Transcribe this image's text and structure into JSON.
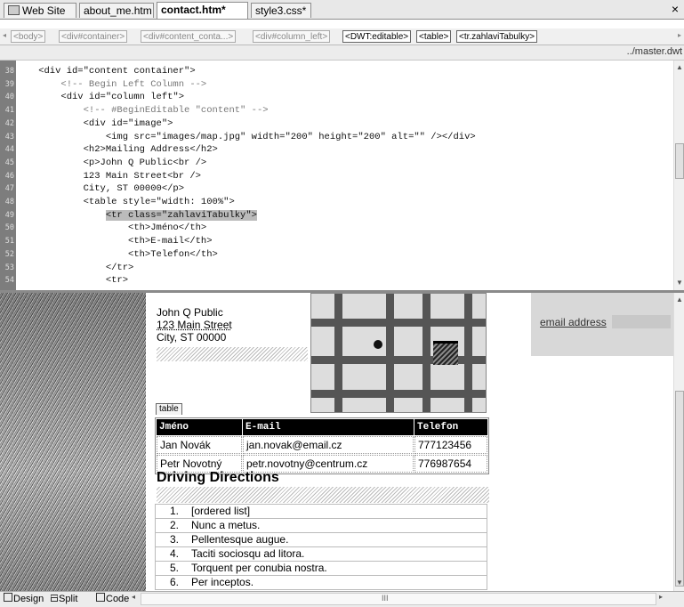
{
  "tabs": [
    {
      "label": "Web Site"
    },
    {
      "label": "about_me.htm"
    },
    {
      "label": "contact.htm*"
    },
    {
      "label": "style3.css*"
    }
  ],
  "close_label": "×",
  "tag_selector": [
    "<body>",
    "<div#container>",
    "<div#content_conta...>",
    "<div#column_left>",
    "<DWT:editable>",
    "<table>",
    "<tr.zahlaviTabulky>"
  ],
  "path_text": "../master.dwt",
  "code_lines": [
    {
      "num": "38",
      "text": "    <div id=\"content container\">"
    },
    {
      "num": "39",
      "text": "        <!-- Begin Left Column -->"
    },
    {
      "num": "40",
      "text": "        <div id=\"column left\">"
    },
    {
      "num": "41",
      "text": "            <!-- #BeginEditable \"content\" -->"
    },
    {
      "num": "42",
      "text": "            <div id=\"image\">"
    },
    {
      "num": "43",
      "text": "                <img src=\"images/map.jpg\" width=\"200\" height=\"200\" alt=\"\" /></div>"
    },
    {
      "num": "44",
      "text": "            <h2>Mailing Address</h2>"
    },
    {
      "num": "45",
      "text": "            <p>John Q Public<br />"
    },
    {
      "num": "46",
      "text": "            123 Main Street<br />"
    },
    {
      "num": "47",
      "text": "            City, ST 00000</p>"
    },
    {
      "num": "48",
      "text": "            <table style=\"width: 100%\">"
    },
    {
      "num": "49",
      "text": "                <tr class=\"zahlaviTabulky\">"
    },
    {
      "num": "50",
      "text": "                    <th>Jméno</th>"
    },
    {
      "num": "51",
      "text": "                    <th>E-mail</th>"
    },
    {
      "num": "52",
      "text": "                    <th>Telefon</th>"
    },
    {
      "num": "53",
      "text": "                </tr>"
    },
    {
      "num": "54",
      "text": "                <tr>"
    }
  ],
  "design": {
    "address": [
      "John Q Public",
      "123 Main Street",
      "City, ST 00000"
    ],
    "table_label": "table",
    "table_headers": [
      "Jméno",
      "E-mail",
      "Telefon"
    ],
    "table_rows": [
      [
        "Jan Novák",
        "jan.novak@email.cz",
        "777123456"
      ],
      [
        "Petr Novotný",
        "petr.novotny@centrum.cz",
        "776987654"
      ]
    ],
    "heading": "Driving Directions",
    "ordered_list": [
      {
        "n": "1.",
        "text": "[ordered list]"
      },
      {
        "n": "2.",
        "text": "Nunc a metus."
      },
      {
        "n": "3.",
        "text": "Pellentesque augue."
      },
      {
        "n": "4.",
        "text": "Taciti sociosqu ad litora."
      },
      {
        "n": "5.",
        "text": "Torquent per conubia nostra."
      },
      {
        "n": "6.",
        "text": "Per inceptos."
      }
    ],
    "email_link": "email address"
  },
  "bottom": {
    "design_label": "Design",
    "split_label": "Split",
    "code_label": "Code",
    "scroll_grip": "III"
  }
}
